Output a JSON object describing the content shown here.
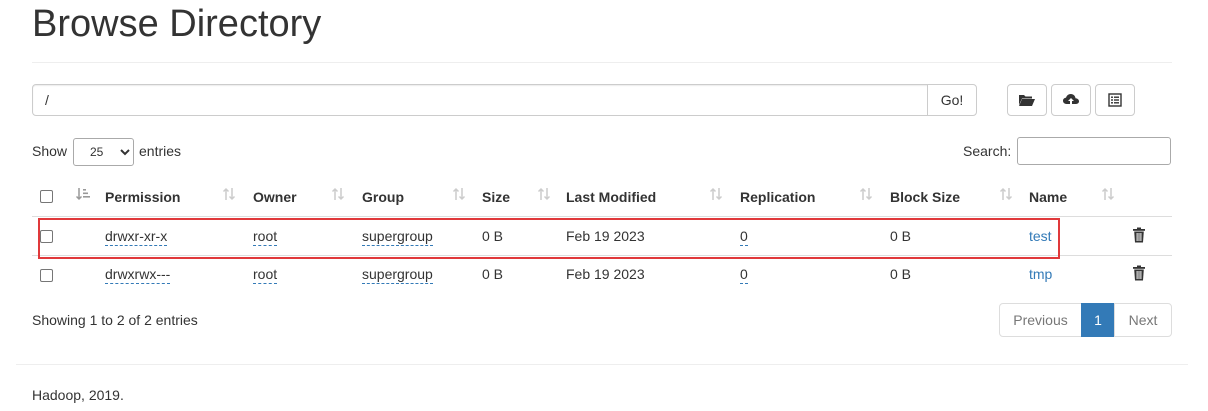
{
  "page": {
    "title": "Browse Directory"
  },
  "pathbar": {
    "value": "/",
    "go_label": "Go!"
  },
  "toolbar": {
    "folder_icon": "folder-open-icon",
    "upload_icon": "cloud-upload-icon",
    "list_icon": "list-alt-icon"
  },
  "length": {
    "show_label": "Show",
    "selected": "25",
    "options": [
      "25"
    ],
    "entries_label": "entries"
  },
  "search": {
    "label": "Search:",
    "value": ""
  },
  "table": {
    "headers": [
      "Permission",
      "Owner",
      "Group",
      "Size",
      "Last Modified",
      "Replication",
      "Block Size",
      "Name"
    ],
    "rows": [
      {
        "permission": "drwxr-xr-x",
        "owner": "root",
        "group": "supergroup",
        "size": "0 B",
        "modified": "Feb 19 2023",
        "replication": "0",
        "block_size": "0 B",
        "name": "test"
      },
      {
        "permission": "drwxrwx---",
        "owner": "root",
        "group": "supergroup",
        "size": "0 B",
        "modified": "Feb 19 2023",
        "replication": "0",
        "block_size": "0 B",
        "name": "tmp"
      }
    ]
  },
  "info": "Showing 1 to 2 of 2 entries",
  "pagination": {
    "previous": "Previous",
    "current": "1",
    "next": "Next"
  },
  "footer": "Hadoop, 2019.",
  "colors": {
    "link": "#337ab7",
    "active_page": "#337ab7",
    "highlight": "#e0393b"
  }
}
